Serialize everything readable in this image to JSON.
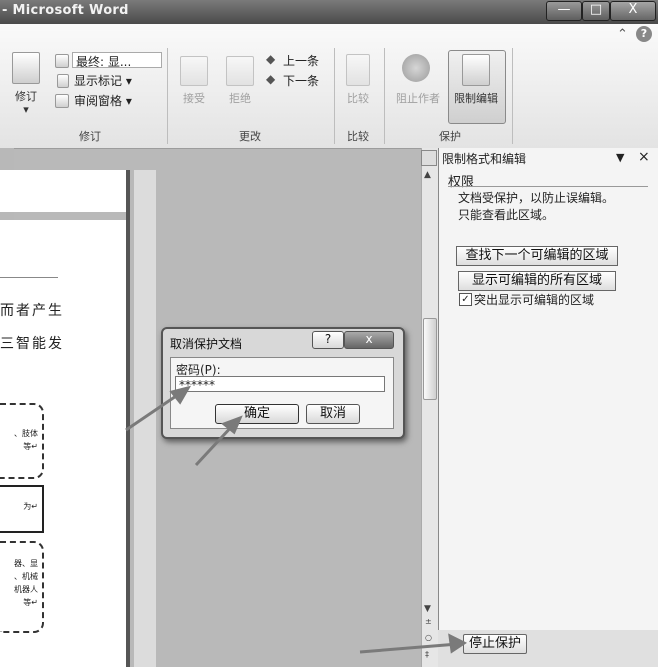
{
  "window": {
    "title": "- Microsoft Word",
    "min": "—",
    "max": "□",
    "close": "X"
  },
  "ribbon": {
    "help": "?",
    "caret": "⌃",
    "track_changes": "修订",
    "final_label": "最终: 显...",
    "show_markup": "显示标记 ▾",
    "reviewing_pane": "审阅窗格 ▾",
    "group_track": "修订",
    "accept": "接受",
    "reject": "拒绝",
    "prev": "上一条",
    "next": "下一条",
    "group_changes": "更改",
    "compare": "比较",
    "group_compare": "比较",
    "block_authors": "阻止作者",
    "restrict_editing": "限制编辑",
    "group_protect": "保护"
  },
  "document": {
    "line1": "而者产生",
    "line2": "三智能发",
    "box1a": "、肢体",
    "box1b": "等↵",
    "box2": "为↵",
    "box3a": "器、显",
    "box3b": "、机械",
    "box3c": "机器人",
    "box3d": "等↵"
  },
  "dialog": {
    "title": "取消保护文档",
    "help": "?",
    "close": "x",
    "password_label": "密码(P):",
    "password_value": "******",
    "ok": "确定",
    "cancel": "取消"
  },
  "pane": {
    "title": "限制格式和编辑",
    "dropdown": "▼",
    "close": "×",
    "section": "权限",
    "text1": "文档受保护，以防止误编辑。",
    "text2": "只能查看此区域。",
    "find_next": "查找下一个可编辑的区域",
    "show_all": "显示可编辑的所有区域",
    "highlight_check": "✓",
    "highlight_label": "突出显示可编辑的区域",
    "stop_protection": "停止保护"
  }
}
